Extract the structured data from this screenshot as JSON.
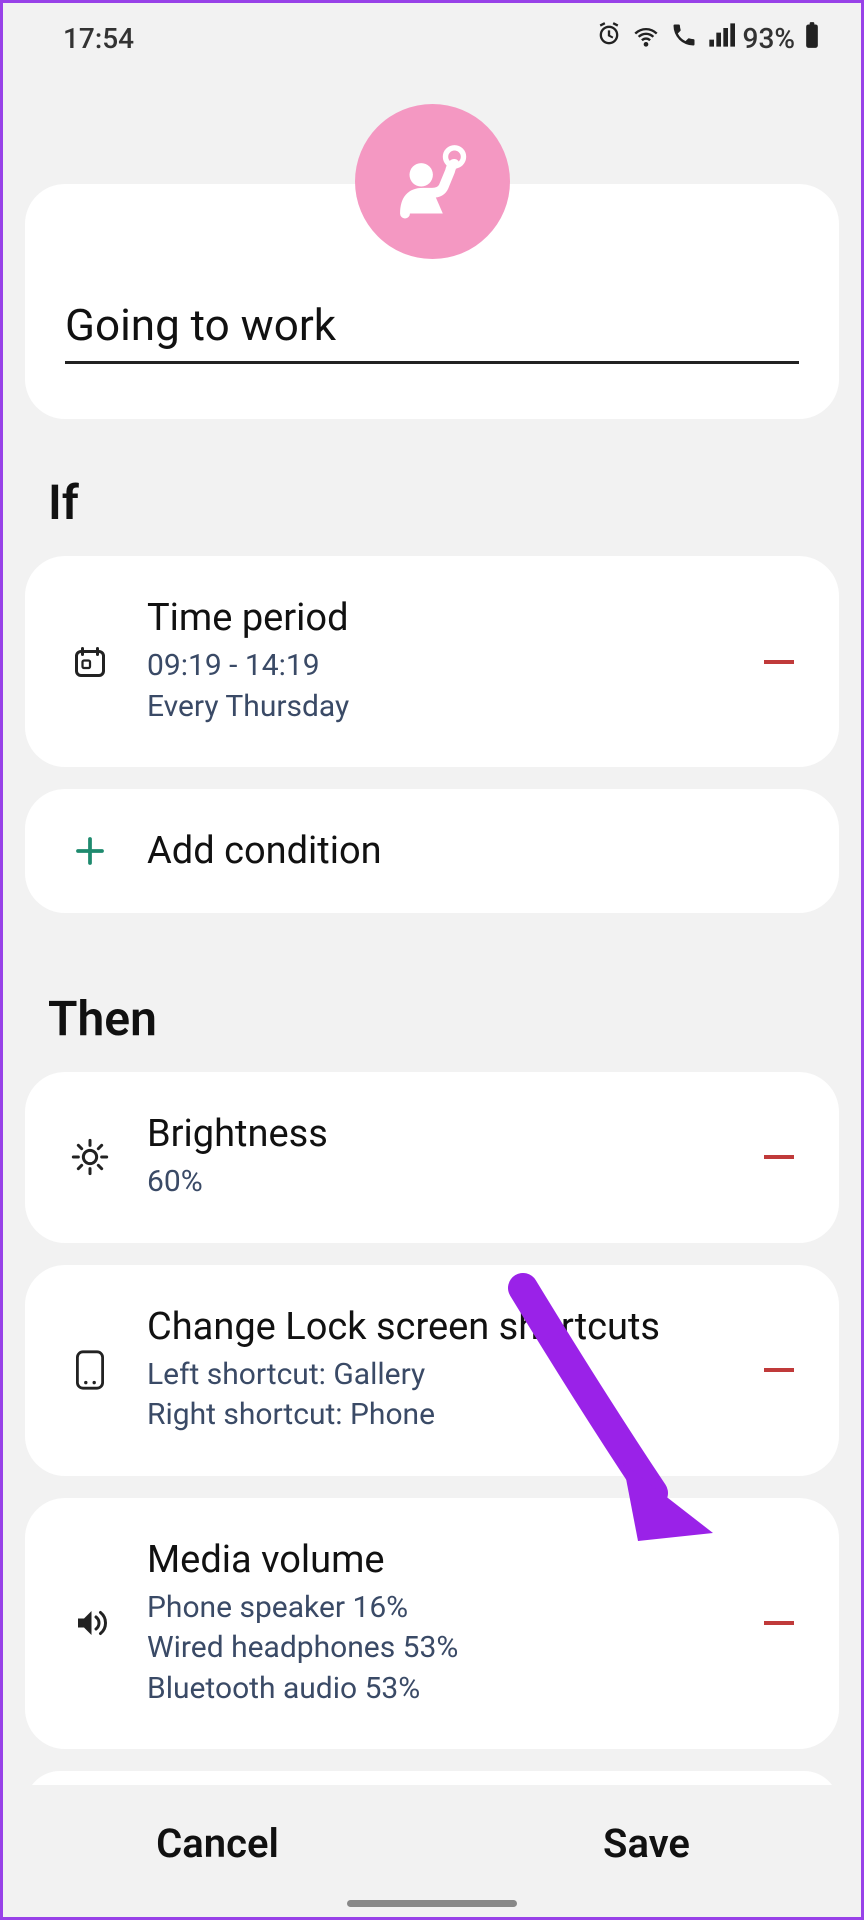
{
  "status": {
    "time": "17:54",
    "battery": "93%"
  },
  "routine": {
    "name": "Going to work"
  },
  "sections": {
    "if_label": "If",
    "then_label": "Then"
  },
  "conditions": [
    {
      "icon": "calendar",
      "title": "Time period",
      "sub1": "09:19 - 14:19",
      "sub2": "Every Thursday"
    }
  ],
  "add_condition_label": "Add condition",
  "actions": [
    {
      "icon": "brightness",
      "title": "Brightness",
      "sub1": "60%"
    },
    {
      "icon": "tablet",
      "title": "Change Lock screen shortcuts",
      "sub1": "Left shortcut: Gallery",
      "sub2": "Right shortcut: Phone"
    },
    {
      "icon": "volume",
      "title": "Media volume",
      "sub1": "Phone speaker 16%",
      "sub2": "Wired headphones 53%",
      "sub3": "Bluetooth audio 53%"
    }
  ],
  "buttons": {
    "cancel": "Cancel",
    "save": "Save"
  }
}
